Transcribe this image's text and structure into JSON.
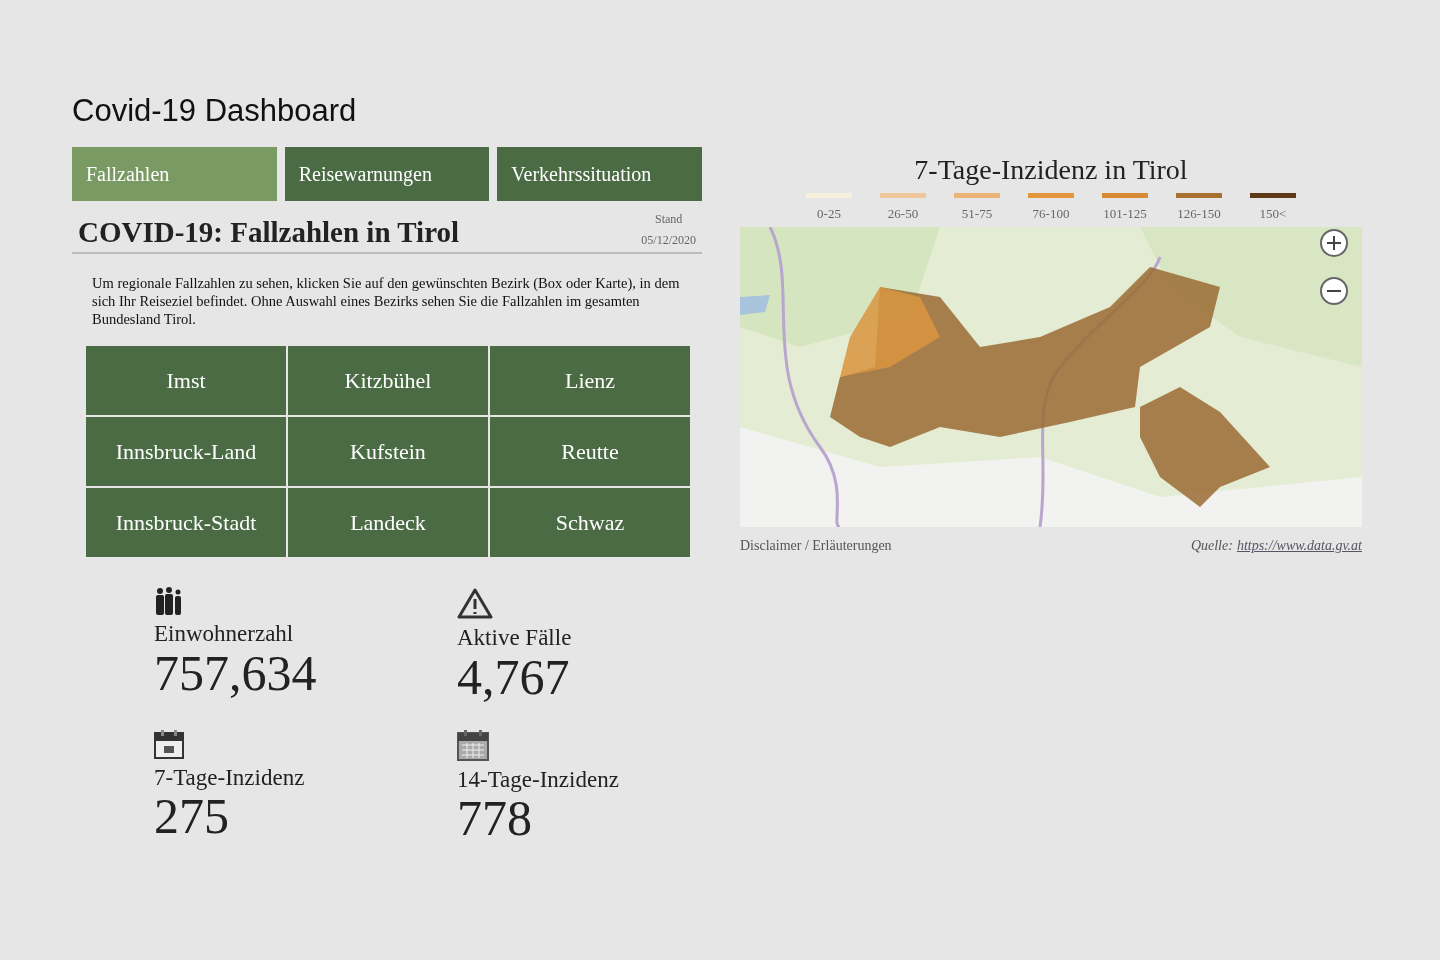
{
  "title": "Covid-19 Dashboard",
  "tabs": [
    {
      "label": "Fallzahlen",
      "selected": true
    },
    {
      "label": "Reisewarnungen",
      "selected": false
    },
    {
      "label": "Verkehrssituation",
      "selected": false
    }
  ],
  "header": {
    "heading": "COVID-19: Fallzahlen in Tirol",
    "stand_label": "Stand",
    "stand_date": "05/12/2020"
  },
  "intro": "Um regionale Fallzahlen zu sehen, klicken Sie auf den gewünschten Bezirk (Box oder Karte), in dem sich Ihr Reiseziel befindet. Ohne Auswahl eines Bezirks sehen Sie die Fallzahlen im gesamten Bundesland Tirol.",
  "districts": [
    "Imst",
    "Kitzbühel",
    "Lienz",
    "Innsbruck-Land",
    "Kufstein",
    "Reutte",
    "Innsbruck-Stadt",
    "Landeck",
    "Schwaz"
  ],
  "stats": [
    {
      "kind": "people",
      "label": "Einwohnerzahl",
      "value": "757,634"
    },
    {
      "kind": "warning",
      "label": "Aktive Fälle",
      "value": "4,767"
    },
    {
      "kind": "calendar",
      "label": "7-Tage-Inzidenz",
      "value": "275"
    },
    {
      "kind": "calendar-grid",
      "label": "14-Tage-Inzidenz",
      "value": "778"
    }
  ],
  "map": {
    "title": "7-Tage-Inzidenz in Tirol",
    "legend": [
      {
        "label": "0-25",
        "color": "#f5efdc"
      },
      {
        "label": "26-50",
        "color": "#f0c79a"
      },
      {
        "label": "51-75",
        "color": "#ecb478"
      },
      {
        "label": "76-100",
        "color": "#e3963c"
      },
      {
        "label": "101-125",
        "color": "#d98a34"
      },
      {
        "label": "126-150",
        "color": "#a8702f"
      },
      {
        "label": "150<",
        "color": "#5c3a16"
      }
    ],
    "disclaimer": "Disclaimer / Erläuterungen",
    "source_label": "Quelle:",
    "source_link": "https://www.data.gv.at"
  }
}
